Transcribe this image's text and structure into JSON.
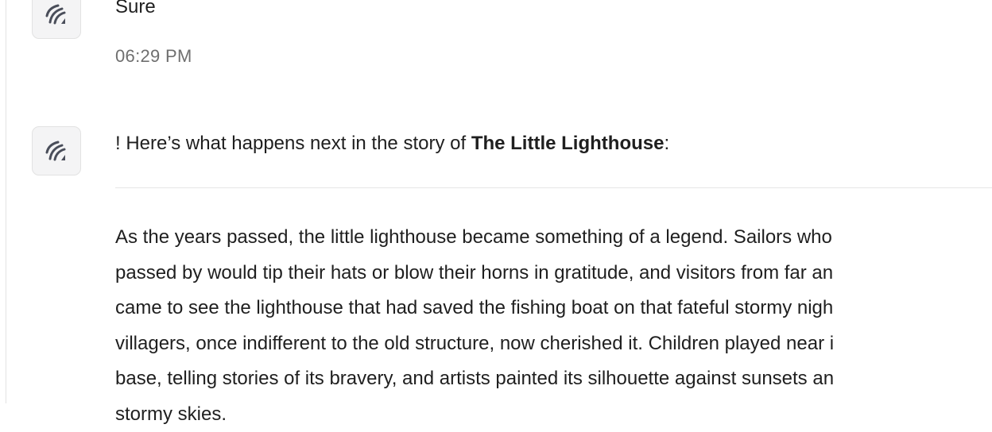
{
  "messages": [
    {
      "avatar_icon": "assistant-logo-icon",
      "text": "Sure",
      "timestamp": "06:29 PM"
    },
    {
      "avatar_icon": "assistant-logo-icon",
      "intro_before": "! Here’s what happens next in the story of ",
      "intro_bold": "The Little Lighthouse",
      "intro_after": ":",
      "story_lines": [
        "As the years passed, the little lighthouse became something of a legend. Sailors who",
        "passed by would tip their hats or blow their horns in gratitude, and visitors from far an",
        "came to see the lighthouse that had saved the fishing boat on that fateful stormy nigh",
        "villagers, once indifferent to the old structure, now cherished it. Children played near i",
        "base, telling stories of its bravery, and artists painted its silhouette against sunsets an",
        "stormy skies."
      ]
    }
  ],
  "colors": {
    "text": "#1f1f1f",
    "timestamp": "#6f6f6f",
    "avatar_bg": "#f4f4f5",
    "avatar_border": "#e2e2e2",
    "icon": "#4a4e5a",
    "divider": "#e6e6e6"
  }
}
